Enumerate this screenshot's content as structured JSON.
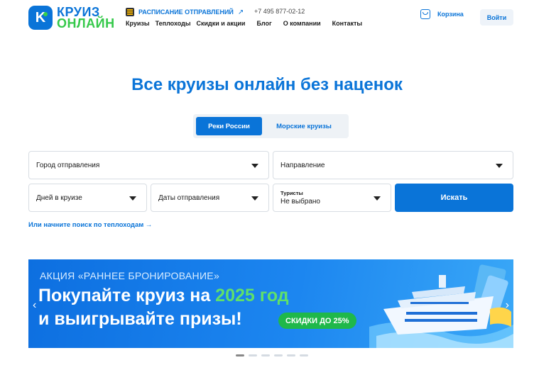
{
  "brand": {
    "logo_letter": "K",
    "line1": "КРУИЗ",
    "line2": "ОНЛАЙН",
    "primary_color": "#0a74d8",
    "accent_color": "#35c94a"
  },
  "header": {
    "schedule_label": "РАСПИСАНИЕ ОТПРАВЛЕНИЙ",
    "schedule_arrow": "↗",
    "phone": "+7 495 877-02-12",
    "cart_label": "Корзина",
    "login_label": "Войти",
    "nav": [
      "Круизы",
      "Теплоходы",
      "Скидки и акции",
      "Блог",
      "О компании",
      "Контакты"
    ]
  },
  "hero": {
    "title": "Все круизы онлайн без наценок"
  },
  "tabs": {
    "rivers": "Реки России",
    "sea": "Морские круизы",
    "active": "rivers"
  },
  "search_form": {
    "city": "Город отправления",
    "direction": "Направление",
    "days": "Дней в круизе",
    "dates": "Даты отправления",
    "tourists_label": "Туристы",
    "tourists_value": "Не выбрано",
    "submit": "Искать",
    "alt_link": "Или начните поиск по теплоходам →"
  },
  "banner": {
    "promo": "АКЦИЯ «РАННЕЕ БРОНИРОВАНИЕ»",
    "line1_a": "Покупайте круиз на ",
    "line1_year": "2025 год",
    "line2": "и выигрывайте призы!",
    "badge": "СКИДКИ ДО 25%",
    "prev": "‹",
    "next": "›"
  },
  "carousel": {
    "slide_count": 6,
    "active_index": 0
  }
}
